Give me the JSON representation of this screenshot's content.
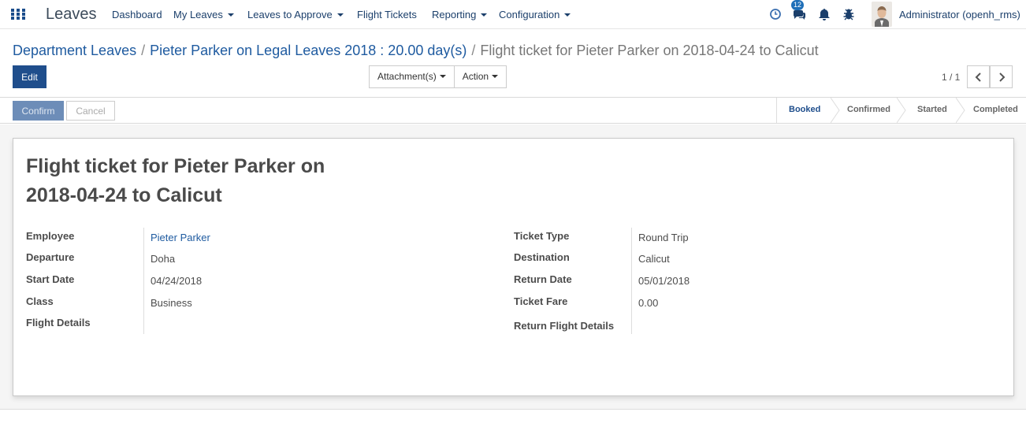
{
  "navbar": {
    "app_title": "Leaves",
    "menu": [
      {
        "label": "Dashboard"
      },
      {
        "label": "My Leaves"
      },
      {
        "label": "Leaves to Approve"
      },
      {
        "label": "Flight Tickets"
      },
      {
        "label": "Reporting"
      },
      {
        "label": "Configuration"
      }
    ],
    "messages_count": "12",
    "user_name": "Administrator (openh_rms)"
  },
  "breadcrumb": {
    "items": [
      "Department Leaves",
      "Pieter Parker on Legal Leaves 2018 : 20.00 day(s)"
    ],
    "current": "Flight ticket for Pieter Parker on 2018-04-24 to Calicut",
    "separator": "/"
  },
  "toolbar": {
    "edit_label": "Edit",
    "attachments_label": "Attachment(s)",
    "action_label": "Action",
    "pager_value": "1 / 1"
  },
  "statusbar": {
    "confirm_label": "Confirm",
    "cancel_label": "Cancel",
    "stages": [
      "Booked",
      "Confirmed",
      "Started",
      "Completed"
    ],
    "active_stage": "Booked"
  },
  "form": {
    "title": "Flight ticket for Pieter Parker on 2018-04-24 to Calicut",
    "left": [
      {
        "label": "Employee",
        "value": "Pieter Parker"
      },
      {
        "label": "Departure",
        "value": "Doha"
      },
      {
        "label": "Start Date",
        "value": "04/24/2018"
      },
      {
        "label": "Class",
        "value": "Business"
      },
      {
        "label": "Flight Details",
        "value": ""
      }
    ],
    "right": [
      {
        "label": "Ticket Type",
        "value": "Round Trip"
      },
      {
        "label": "Destination",
        "value": "Calicut"
      },
      {
        "label": "Return Date",
        "value": "05/01/2018"
      },
      {
        "label": "Ticket Fare",
        "value": "0.00"
      },
      {
        "label": "Return Flight Details",
        "value": ""
      }
    ]
  },
  "colors": {
    "primary": "#1f4e8c",
    "link": "#1f5ba0",
    "badge": "#1f6fb8"
  }
}
